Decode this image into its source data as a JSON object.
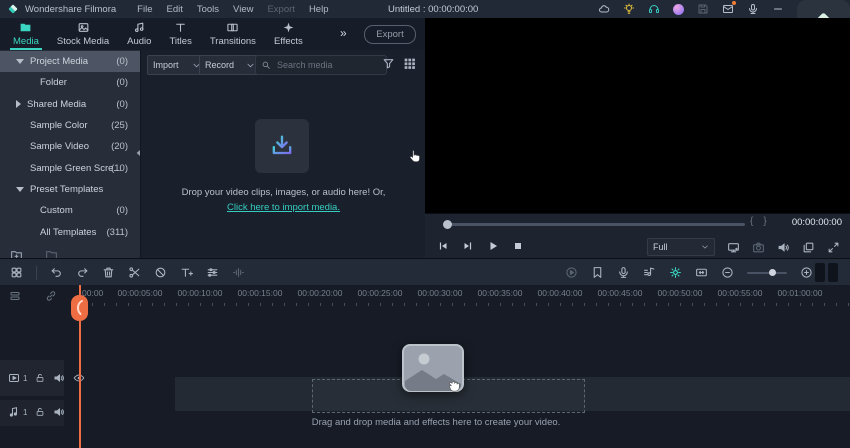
{
  "app": {
    "name": "Wondershare Filmora",
    "title": "Untitled : 00:00:00:00",
    "menu": [
      {
        "label": "File",
        "disabled": false
      },
      {
        "label": "Edit",
        "disabled": false
      },
      {
        "label": "Tools",
        "disabled": false
      },
      {
        "label": "View",
        "disabled": false
      },
      {
        "label": "Export",
        "disabled": true
      },
      {
        "label": "Help",
        "disabled": false
      }
    ],
    "top_icons": [
      {
        "name": "cloud-icon",
        "icon": "cloud"
      },
      {
        "name": "ideas-bulb-icon",
        "icon": "bulb",
        "tint": "#e8c43c"
      },
      {
        "name": "support-headset-icon",
        "icon": "headset",
        "tint": "#35cdc0"
      },
      {
        "name": "account-avatar",
        "icon": "avatar"
      },
      {
        "name": "save-icon",
        "icon": "floppy",
        "state": "dim"
      },
      {
        "name": "messages-icon",
        "icon": "envelope",
        "dot": "#f07c35"
      },
      {
        "name": "voice-icon",
        "icon": "mic"
      },
      {
        "name": "minimize-icon",
        "icon": "minus"
      }
    ]
  },
  "tabs": {
    "items": [
      {
        "label": "Media",
        "icon": "folder",
        "active": true
      },
      {
        "label": "Stock Media",
        "icon": "stock",
        "active": false
      },
      {
        "label": "Audio",
        "icon": "audio",
        "active": false
      },
      {
        "label": "Titles",
        "icon": "titles",
        "active": false
      },
      {
        "label": "Transitions",
        "icon": "transitions",
        "active": false
      },
      {
        "label": "Effects",
        "icon": "effects",
        "active": false
      }
    ],
    "more": "»",
    "export_label": "Export"
  },
  "sidebar": {
    "items": [
      {
        "label": "Project Media",
        "count": "(0)",
        "caret": "down",
        "selected": true,
        "indent": 0
      },
      {
        "label": "Folder",
        "count": "(0)",
        "caret": "none",
        "selected": false,
        "indent": 1
      },
      {
        "label": "Shared Media",
        "count": "(0)",
        "caret": "right",
        "selected": false,
        "indent": 0
      },
      {
        "label": "Sample Color",
        "count": "(25)",
        "caret": "none",
        "selected": false,
        "indent": 0
      },
      {
        "label": "Sample Video",
        "count": "(20)",
        "caret": "none",
        "selected": false,
        "indent": 0
      },
      {
        "label": "Sample Green Scre...",
        "count": "(10)",
        "caret": "none",
        "selected": false,
        "indent": 0
      },
      {
        "label": "Preset Templates",
        "count": "",
        "caret": "down",
        "selected": false,
        "indent": 0
      },
      {
        "label": "Custom",
        "count": "(0)",
        "caret": "none",
        "selected": false,
        "indent": 1
      },
      {
        "label": "All Templates",
        "count": "(311)",
        "caret": "none",
        "selected": false,
        "indent": 1
      }
    ]
  },
  "media_panel": {
    "import_label": "Import",
    "record_label": "Record",
    "search_placeholder": "Search media",
    "drop_text": "Drop your video clips, images, or audio here! Or,",
    "import_link": "Click here to import media."
  },
  "preview": {
    "timecode": "00:00:00:00",
    "zoom_level": "Full",
    "mark_in": "{",
    "mark_out": "}",
    "transport": [
      {
        "name": "previous-frame-button",
        "icon": "prevframe"
      },
      {
        "name": "next-frame-button",
        "icon": "nextframe"
      },
      {
        "name": "play-button",
        "icon": "play"
      },
      {
        "name": "stop-button",
        "icon": "stop"
      }
    ],
    "right_icons": [
      {
        "name": "secondary-display-icon",
        "icon": "monitor"
      },
      {
        "name": "snapshot-icon",
        "icon": "camera",
        "state": "dim"
      },
      {
        "name": "mute-speaker-icon",
        "icon": "speaker"
      },
      {
        "name": "detach-panel-icon",
        "icon": "layers"
      },
      {
        "name": "fullscreen-icon",
        "icon": "expand"
      }
    ]
  },
  "timeline_toolbar": {
    "left": [
      {
        "name": "media-view-toggle-icon",
        "icon": "grid4"
      },
      {
        "name": "undo-button",
        "icon": "undo"
      },
      {
        "name": "redo-button",
        "icon": "redo"
      },
      {
        "name": "delete-button",
        "icon": "trash"
      },
      {
        "name": "split-button",
        "icon": "scissors"
      },
      {
        "name": "crop-button",
        "icon": "slashcircle"
      },
      {
        "name": "add-text-button",
        "icon": "textadd"
      },
      {
        "name": "properties-button",
        "icon": "sliders"
      },
      {
        "name": "audio-denoise-button",
        "icon": "denoise",
        "state": "dim"
      }
    ],
    "right": [
      {
        "name": "render-preview-button",
        "icon": "playcirc",
        "state": "dim"
      },
      {
        "name": "add-marker-button",
        "icon": "marker"
      },
      {
        "name": "voiceover-button",
        "icon": "mic"
      },
      {
        "name": "audio-mixer-button",
        "icon": "mixer"
      },
      {
        "name": "keyframe-button",
        "icon": "keyframe",
        "state": "teal"
      },
      {
        "name": "fit-timeline-button",
        "icon": "fit"
      },
      {
        "name": "zoom-out-button",
        "icon": "zoomout"
      },
      {
        "name": "zoom-in-button",
        "icon": "zoomin"
      }
    ]
  },
  "timeline": {
    "ruler_labels": [
      "00:00",
      "00:00:05:00",
      "00:00:10:00",
      "00:00:15:00",
      "00:00:20:00",
      "00:00:25:00",
      "00:00:30:00",
      "00:00:35:00",
      "00:00:40:00",
      "00:00:45:00",
      "00:00:50:00",
      "00:00:55:00",
      "00:01:00:00"
    ],
    "video_track_number": "1",
    "audio_track_number": "1",
    "drop_hint": "Drag and drop media and effects here to create your video."
  },
  "colors": {
    "accent_teal": "#3bd6c3",
    "playhead_orange": "#ef6d43",
    "notification_orange": "#f07c35",
    "selected_row": "#4d5564"
  }
}
